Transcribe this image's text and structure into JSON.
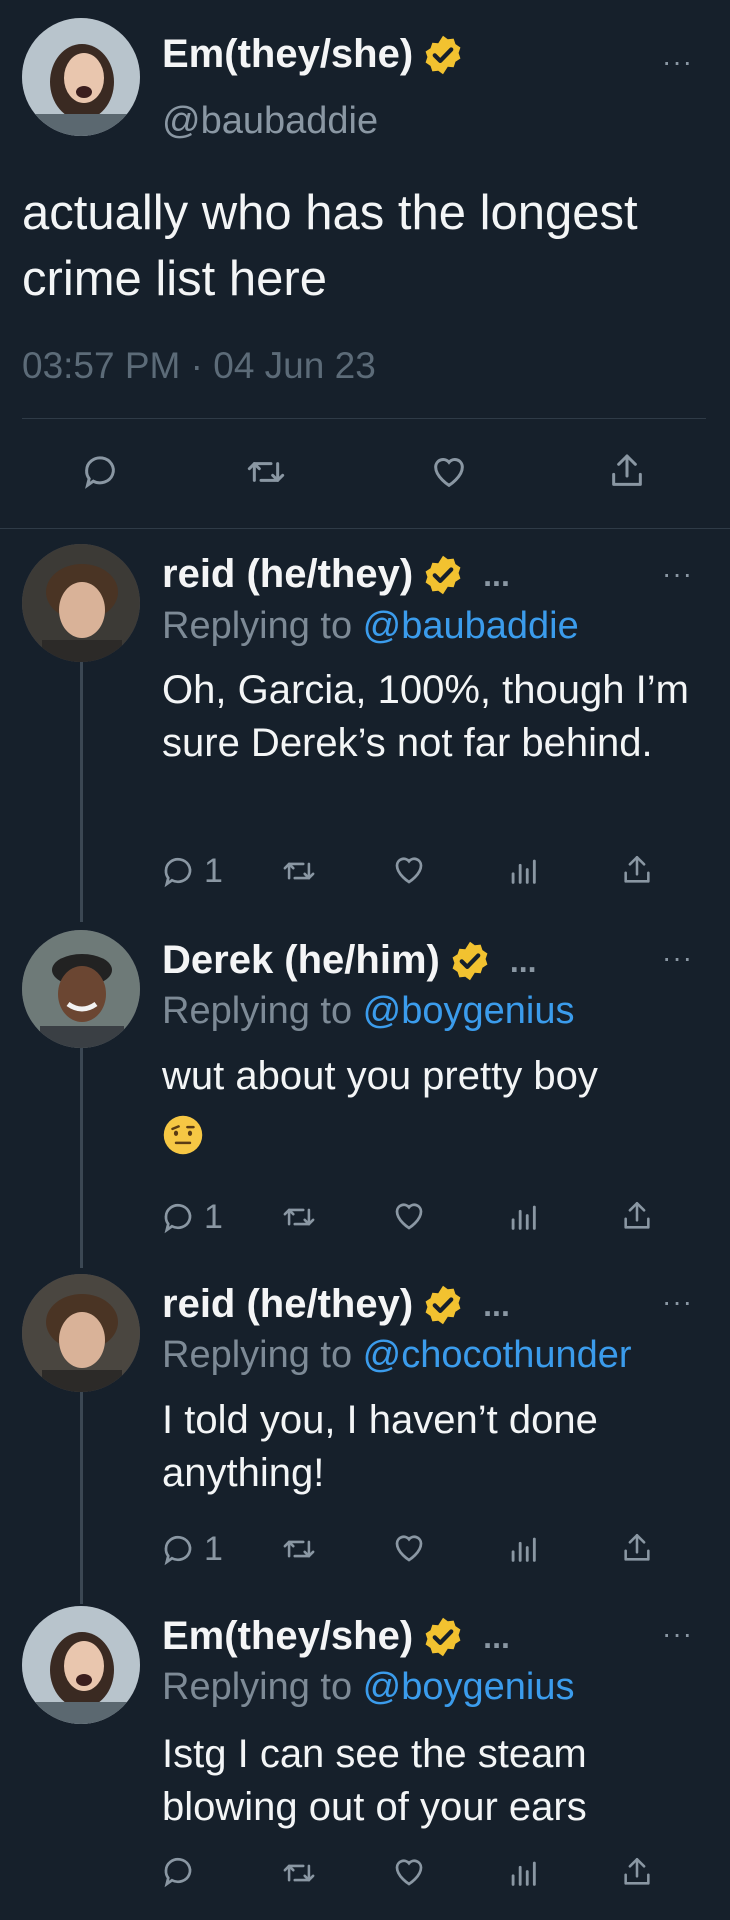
{
  "main_tweet": {
    "author_name": "Em(they/she)",
    "handle": "@baubaddie",
    "text": "actually who has the longest crime list here",
    "timestamp": "03:57 PM · 04 Jun 23",
    "more": "···"
  },
  "replies": [
    {
      "author_name": "reid (he/they)",
      "trail": "...",
      "more": "···",
      "replying_prefix": "Replying to ",
      "replying_to": "@baubaddie",
      "text": "Oh, Garcia, 100%, though I’m sure Derek’s not far behind.",
      "reply_count": "1"
    },
    {
      "author_name": "Derek (he/him)",
      "trail": "...",
      "more": "···",
      "replying_prefix": "Replying to ",
      "replying_to": "@boygenius",
      "text": "wut about you pretty boy",
      "emoji": "raised-eyebrow-face",
      "reply_count": "1"
    },
    {
      "author_name": "reid (he/they)",
      "trail": "...",
      "more": "···",
      "replying_prefix": "Replying to ",
      "replying_to": "@chocothunder",
      "text": "I told you, I haven’t done anything!",
      "reply_count": "1"
    },
    {
      "author_name": "Em(they/she)",
      "trail": "...",
      "more": "···",
      "replying_prefix": "Replying to ",
      "replying_to": "@boygenius",
      "text": "Istg I can see the steam blowing out of your ears"
    }
  ],
  "colors": {
    "background": "#16202b",
    "mention": "#3b9cec",
    "muted": "#8a97a3",
    "badge": "#f2c230"
  }
}
